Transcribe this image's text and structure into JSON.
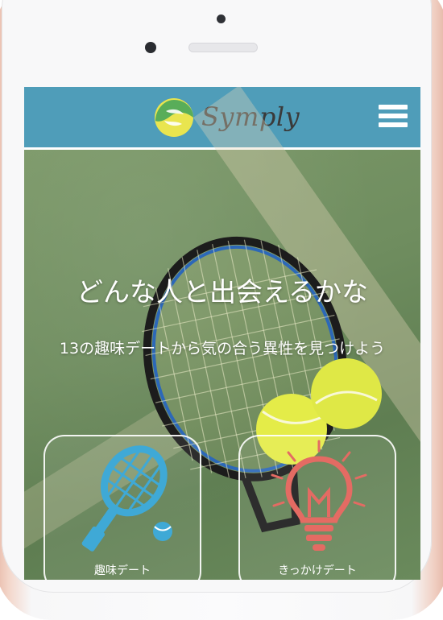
{
  "app": {
    "brand": "Symply"
  },
  "hero": {
    "headline": "どんな人と出会えるかな",
    "subline": "13の趣味デートから気の合う異性を見つけよう"
  },
  "cards": [
    {
      "label": "趣味デート",
      "icon": "tennis-racket-icon"
    },
    {
      "label": "きっかけデート",
      "icon": "lightbulb-icon"
    }
  ],
  "colors": {
    "header": "#4f9db9",
    "logo_yellow": "#e9e54f",
    "racket_blue": "#3fa9d6",
    "bulb_red": "#e46b63",
    "ball": "#e7f04a"
  }
}
